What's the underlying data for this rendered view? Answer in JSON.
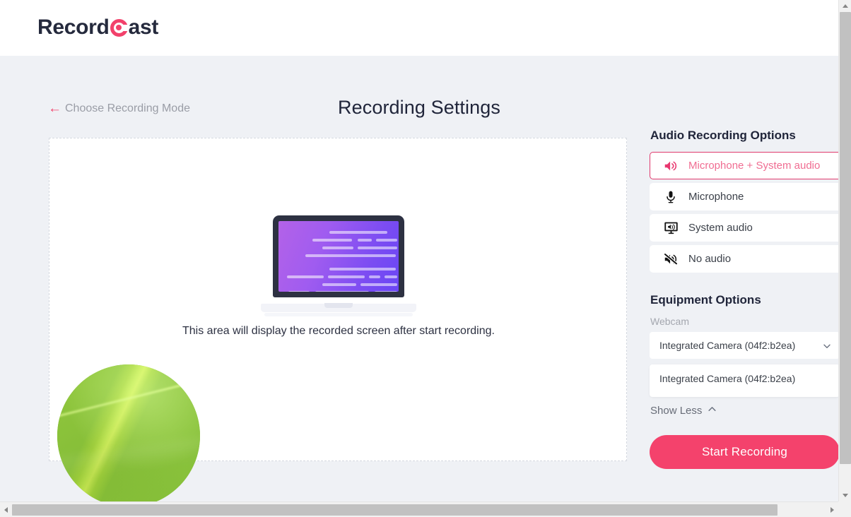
{
  "header": {
    "logo_before": "Record",
    "logo_mark": "record-c-mark",
    "logo_after": "ast",
    "brand_color": "#f2416b"
  },
  "nav": {
    "back_label": "Choose Recording Mode",
    "back_arrow": "arrow-left-icon"
  },
  "page": {
    "title": "Recording Settings"
  },
  "preview": {
    "caption": "This area will display the recorded screen after start recording.",
    "illustration": "laptop-illustration",
    "webcam_overlay": "webcam-circle-preview"
  },
  "audio": {
    "title": "Audio Recording Options",
    "selected": "Microphone + System audio",
    "options": [
      {
        "label": "Microphone + System audio",
        "icon": "speaker-on-icon",
        "selected": true
      },
      {
        "label": "Microphone",
        "icon": "microphone-icon",
        "selected": false
      },
      {
        "label": "System audio",
        "icon": "monitor-speaker-icon",
        "selected": false
      },
      {
        "label": "No audio",
        "icon": "speaker-muted-icon",
        "selected": false
      }
    ]
  },
  "equipment": {
    "title": "Equipment Options",
    "webcam_label": "Webcam",
    "webcam_selected": "Integrated Camera (04f2:b2ea)",
    "webcam_chevron": "chevron-down-icon",
    "webcam_options": [
      "Integrated Camera (04f2:b2ea)",
      ""
    ],
    "show_less_label": "Show Less",
    "show_less_chevron": "chevron-up-icon"
  },
  "actions": {
    "start_recording": "Start Recording",
    "start_recording_color": "#f4426c"
  },
  "scrollbars": {
    "vertical_up": "scroll-up-arrow",
    "vertical_down": "scroll-down-arrow",
    "horizontal_left": "scroll-left-arrow",
    "horizontal_right": "scroll-right-arrow"
  }
}
